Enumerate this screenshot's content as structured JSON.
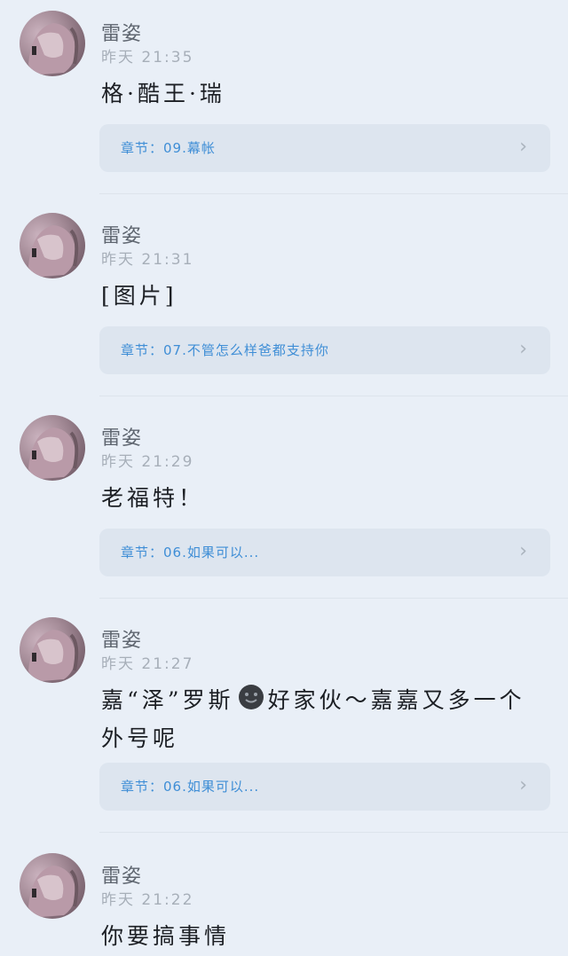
{
  "comments": [
    {
      "author": "雷姿",
      "time": "昨天 21:35",
      "text": "格·酷王·瑞",
      "chapter_label": "章节：09.幕帐",
      "chevron": "›"
    },
    {
      "author": "雷姿",
      "time": "昨天 21:31",
      "text": "[图片]",
      "chapter_label": "章节：07.不管怎么样爸都支持你",
      "chevron": "›"
    },
    {
      "author": "雷姿",
      "time": "昨天 21:29",
      "text": "老福特！",
      "chapter_label": "章节：06.如果可以...",
      "chevron": "›"
    },
    {
      "author": "雷姿",
      "time": "昨天 21:27",
      "text_before_emoji": "嘉“泽”罗斯",
      "emoji_icon": "smiling-face-dark-icon",
      "text_after_emoji": "好家伙～嘉嘉又多一个外号呢",
      "chapter_label": "章节：06.如果可以...",
      "chevron": "›"
    },
    {
      "author": "雷姿",
      "time": "昨天 21:22",
      "text": "你要搞事情"
    }
  ],
  "colors": {
    "background": "#e9eff7",
    "card": "#dde5ef",
    "link": "#3f8ed6",
    "time": "#a7afb9"
  }
}
